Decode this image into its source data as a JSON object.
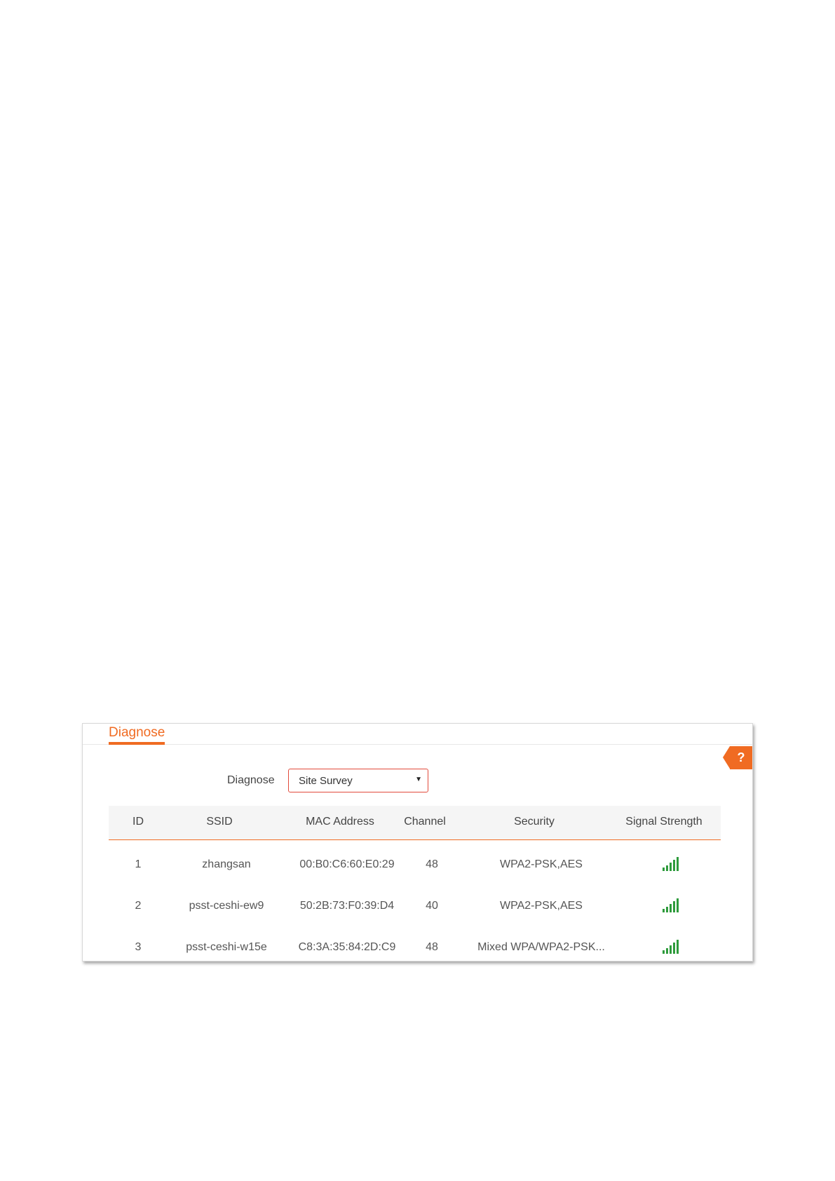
{
  "panel": {
    "title": "Diagnose",
    "help_label": "?"
  },
  "form": {
    "label": "Diagnose",
    "select_value": "Site Survey",
    "select_arrow": "▼"
  },
  "table": {
    "columns": [
      "ID",
      "SSID",
      "MAC Address",
      "Channel",
      "Security",
      "Signal Strength"
    ],
    "rows": [
      {
        "id": "1",
        "ssid": "zhangsan",
        "mac": "00:B0:C6:60:E0:29",
        "channel": "48",
        "security": "WPA2-PSK,AES",
        "signal": "signal-bars-icon"
      },
      {
        "id": "2",
        "ssid": "psst-ceshi-ew9",
        "mac": "50:2B:73:F0:39:D4",
        "channel": "40",
        "security": "WPA2-PSK,AES",
        "signal": "signal-bars-icon"
      },
      {
        "id": "3",
        "ssid": "psst-ceshi-w15e",
        "mac": "C8:3A:35:84:2D:C9",
        "channel": "48",
        "security": "Mixed WPA/WPA2-PSK...",
        "signal": "signal-bars-icon"
      }
    ]
  },
  "colors": {
    "accent": "#f06b22",
    "signal": "#2e9b3c",
    "select_border": "#e24a3b"
  }
}
